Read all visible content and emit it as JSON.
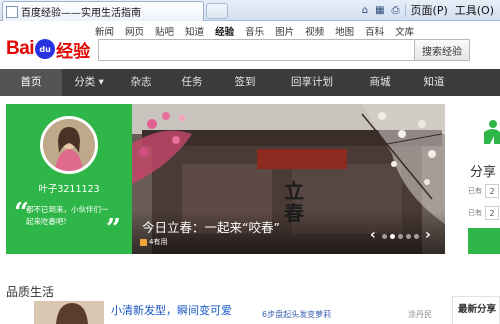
{
  "browser": {
    "tab_title": "百度经验——实用生活指南",
    "tools": {
      "page_label": "页面(P)",
      "tools_label": "工具(O)"
    }
  },
  "site": {
    "logo": {
      "bai": "Bai",
      "du": "du",
      "jy": "经验"
    },
    "topnav": [
      "新闻",
      "网页",
      "贴吧",
      "知道",
      "经验",
      "音乐",
      "图片",
      "视频",
      "地图",
      "百科",
      "文库"
    ],
    "topnav_active": "经验",
    "search": {
      "value": "",
      "button_label": "搜索经验"
    }
  },
  "mainnav": {
    "items": [
      "首页",
      "分类",
      "杂志",
      "任务",
      "签到",
      "回享计划",
      "商城",
      "知道"
    ],
    "active": "首页",
    "dropdown_marker": "▾"
  },
  "hero": {
    "user": {
      "name": "叶子3211123"
    },
    "quote": "都不已到来，小伙伴们一起来吃春吧!",
    "slide": {
      "caption": "今日立春：一起来“咬春”",
      "useful": "4有用",
      "vertical_text": "立春",
      "dots": 5,
      "active_dot": 1
    },
    "share": {
      "title": "分享",
      "row_label": "已有",
      "row_value": "2"
    }
  },
  "bottom": {
    "section_title": "品质生活",
    "article_main": "小清新发型，瞬间变可爱",
    "article_second": "6步盘起头发变萝莉",
    "article_author": "涂丹民",
    "latest_title": "最新分享"
  },
  "colors": {
    "brand_red": "#e10601",
    "brand_blue": "#2932e1",
    "green": "#2fb648",
    "nav_bg": "#3b3b3b",
    "link_blue": "#1a58c4"
  }
}
